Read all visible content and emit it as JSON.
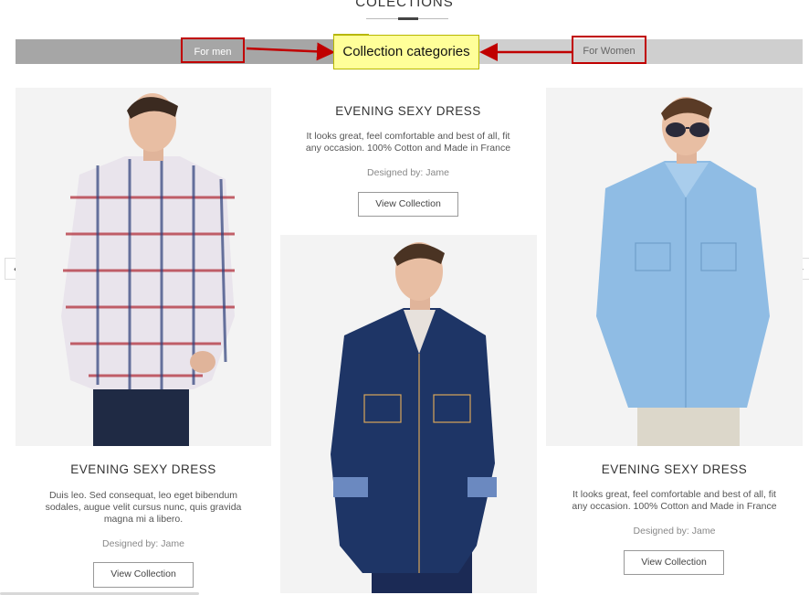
{
  "header": {
    "title": "COLECTIONS"
  },
  "tabs": {
    "men": "For men",
    "women": "For Women"
  },
  "annotation": {
    "callout_text": "Collection categories",
    "arrow_color": "#c00000"
  },
  "cards": {
    "left": {
      "title": "EVENING SEXY DRESS",
      "description": "Duis leo. Sed consequat, leo eget bibendum sodales, augue velit cursus nunc, quis gravida magna mi a libero.",
      "designer": "Designed by: Jame",
      "button": "View Collection",
      "image": "man-plaid-shirt-photo"
    },
    "middle": {
      "title": "EVENING SEXY DRESS",
      "description": "It looks great, feel comfortable and best of all, fit any occasion. 100% Cotton and Made in France",
      "designer": "Designed by: Jame",
      "button": "View Collection",
      "image": "man-denim-jacket-photo"
    },
    "right": {
      "title": "EVENING SEXY DRESS",
      "description": "It looks great, feel comfortable and best of all, fit any occasion. 100% Cotton and Made in France",
      "designer": "Designed by: Jame",
      "button": "View Collection",
      "image": "man-light-blue-shirt-sunglasses-photo"
    }
  },
  "carousel": {
    "prev_icon": "chevron-left-icon",
    "next_icon": "chevron-right-icon"
  },
  "colors": {
    "accent_red": "#c00000",
    "callout_yellow": "#ffff99",
    "tab_men_bg": "#a6a6a6",
    "tab_women_bg": "#cfcfcf"
  }
}
